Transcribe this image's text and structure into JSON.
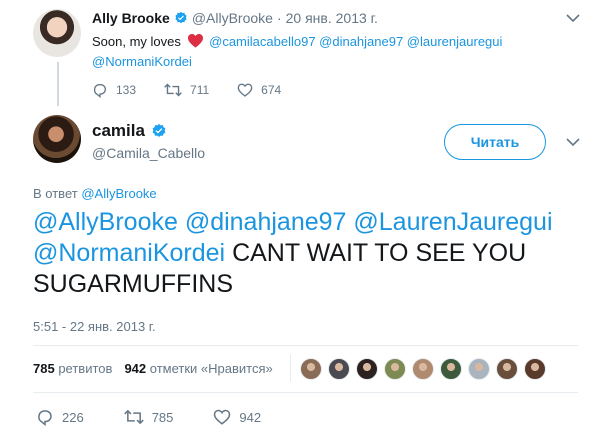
{
  "parent_tweet": {
    "display_name": "Ally Brooke",
    "handle": "@AllyBrooke",
    "separator": "·",
    "date": "20 янв. 2013 г.",
    "text_prefix": "Soon, my loves",
    "mentions_line1": "@camilacabello97 @dinahjane97 @laurenjaureguі",
    "mentions_line2": "@NormaniKordei",
    "replies": "133",
    "retweets": "711",
    "likes": "674"
  },
  "main_tweet": {
    "display_name": "camila",
    "handle": "@Camila_Cabello",
    "follow_label": "Читать",
    "reply_to_prefix": "В ответ",
    "reply_to_handle": "@AllyBrooke",
    "text_mentions_1": "@AllyBrooke @dinahjane97 @LaurenJauregui",
    "text_mentions_2": "@NormaniKordei",
    "text_body": "CANT WAIT TO SEE YOU",
    "text_line3": "SUGARMUFFINS",
    "timestamp": "5:51 - 22 янв. 2013 г.",
    "retweets_count": "785",
    "retweets_label": "ретвитов",
    "likes_count": "942",
    "likes_label": "отметки «Нравится»",
    "replies": "226",
    "retweets": "785",
    "likes": "942"
  },
  "likers_colors": [
    "#8a6b55",
    "#4a4a52",
    "#2c2220",
    "#7d8a52",
    "#b08a6e",
    "#3d5a3a",
    "#aab4be",
    "#6a4e3c",
    "#5a3a2a"
  ],
  "colors": {
    "link": "#1b95e0",
    "secondary": "#657786",
    "heart": "#e0245e"
  },
  "icons": [
    "verified-badge-icon",
    "heart-emoji-icon",
    "reply-icon",
    "retweet-icon",
    "like-icon",
    "chevron-down-icon"
  ]
}
